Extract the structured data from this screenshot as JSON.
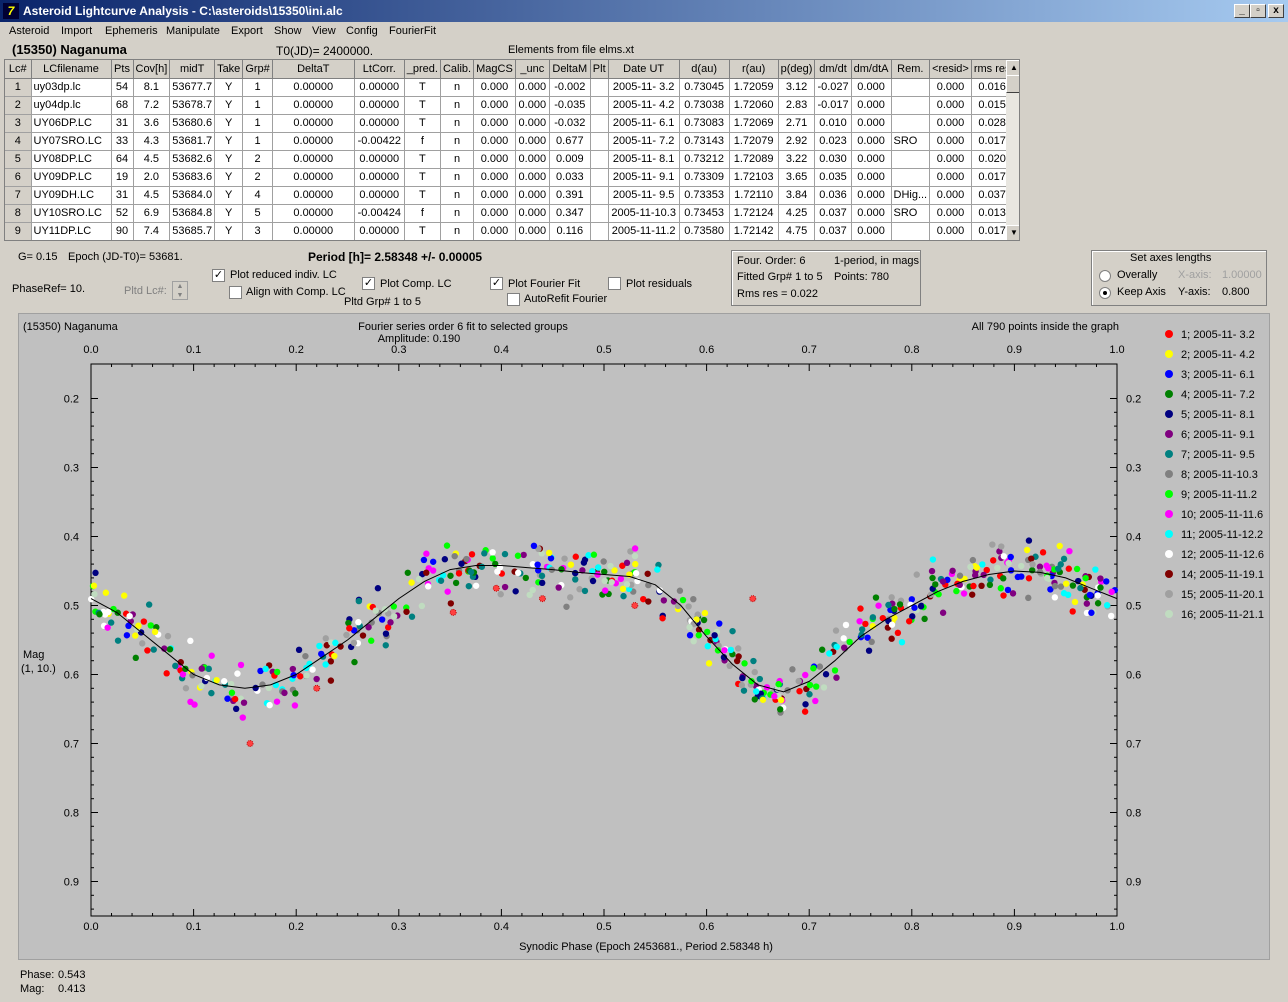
{
  "window": {
    "title": "Asteroid Lightcurve Analysis - C:\\asteroids\\15350\\ini.alc",
    "controls": [
      "_",
      "▫",
      "x"
    ]
  },
  "menu": [
    "Asteroid",
    "Import",
    "Ephemeris",
    "Manipulate",
    "Export",
    "Show",
    "View",
    "Config",
    "FourierFit"
  ],
  "header": {
    "asteroid": "(15350) Naganuma",
    "t0": "T0(JD)= 2400000.",
    "elements": "Elements from file elms.xt"
  },
  "table": {
    "columns": [
      "Lc#",
      "LCfilename",
      "Pts",
      "Cov[h]",
      "midT",
      "Take",
      "Grp#",
      "DeltaT",
      "LtCorr.",
      "_pred.",
      "Calib.",
      "MagCS",
      "_unc",
      "DeltaM",
      "Plt",
      "Date UT",
      "d(au)",
      "r(au)",
      "p(deg)",
      "dm/dt",
      "dm/dtA",
      "Rem.",
      "<resid>",
      "rms res"
    ],
    "rows": [
      [
        "1",
        "uy03dp.lc",
        "54",
        "8.1",
        "53677.7",
        "Y",
        "1",
        "0.00000",
        "0.00000",
        "T",
        "n",
        "0.000",
        "0.000",
        "-0.002",
        "",
        "2005-11- 3.2",
        "0.73045",
        "1.72059",
        "3.12",
        "-0.027",
        "0.000",
        "",
        "0.000",
        "0.016"
      ],
      [
        "2",
        "uy04dp.lc",
        "68",
        "7.2",
        "53678.7",
        "Y",
        "1",
        "0.00000",
        "0.00000",
        "T",
        "n",
        "0.000",
        "0.000",
        "-0.035",
        "",
        "2005-11- 4.2",
        "0.73038",
        "1.72060",
        "2.83",
        "-0.017",
        "0.000",
        "",
        "0.000",
        "0.015"
      ],
      [
        "3",
        "UY06DP.LC",
        "31",
        "3.6",
        "53680.6",
        "Y",
        "1",
        "0.00000",
        "0.00000",
        "T",
        "n",
        "0.000",
        "0.000",
        "-0.032",
        "",
        "2005-11- 6.1",
        "0.73083",
        "1.72069",
        "2.71",
        "0.010",
        "0.000",
        "",
        "0.000",
        "0.028"
      ],
      [
        "4",
        "UY07SRO.LC",
        "33",
        "4.3",
        "53681.7",
        "Y",
        "1",
        "0.00000",
        "-0.00422",
        "f",
        "n",
        "0.000",
        "0.000",
        "0.677",
        "",
        "2005-11- 7.2",
        "0.73143",
        "1.72079",
        "2.92",
        "0.023",
        "0.000",
        "SRO",
        "0.000",
        "0.017"
      ],
      [
        "5",
        "UY08DP.LC",
        "64",
        "4.5",
        "53682.6",
        "Y",
        "2",
        "0.00000",
        "0.00000",
        "T",
        "n",
        "0.000",
        "0.000",
        "0.009",
        "",
        "2005-11- 8.1",
        "0.73212",
        "1.72089",
        "3.22",
        "0.030",
        "0.000",
        "",
        "0.000",
        "0.020"
      ],
      [
        "6",
        "UY09DP.LC",
        "19",
        "2.0",
        "53683.6",
        "Y",
        "2",
        "0.00000",
        "0.00000",
        "T",
        "n",
        "0.000",
        "0.000",
        "0.033",
        "",
        "2005-11- 9.1",
        "0.73309",
        "1.72103",
        "3.65",
        "0.035",
        "0.000",
        "",
        "0.000",
        "0.017"
      ],
      [
        "7",
        "UY09DH.LC",
        "31",
        "4.5",
        "53684.0",
        "Y",
        "4",
        "0.00000",
        "0.00000",
        "T",
        "n",
        "0.000",
        "0.000",
        "0.391",
        "",
        "2005-11- 9.5",
        "0.73353",
        "1.72110",
        "3.84",
        "0.036",
        "0.000",
        "DHig...",
        "0.000",
        "0.037"
      ],
      [
        "8",
        "UY10SRO.LC",
        "52",
        "6.9",
        "53684.8",
        "Y",
        "5",
        "0.00000",
        "-0.00424",
        "f",
        "n",
        "0.000",
        "0.000",
        "0.347",
        "",
        "2005-11-10.3",
        "0.73453",
        "1.72124",
        "4.25",
        "0.037",
        "0.000",
        "SRO",
        "0.000",
        "0.013"
      ],
      [
        "9",
        "UY11DP.LC",
        "90",
        "7.4",
        "53685.7",
        "Y",
        "3",
        "0.00000",
        "0.00000",
        "T",
        "n",
        "0.000",
        "0.000",
        "0.116",
        "",
        "2005-11-11.2",
        "0.73580",
        "1.72142",
        "4.75",
        "0.037",
        "0.000",
        "",
        "0.000",
        "0.017"
      ]
    ]
  },
  "controls": {
    "g_label": "G= 0.15",
    "epoch_label": "Epoch (JD-T0)= 53681.",
    "period_label": "Period [h]= 2.58348 +/- 0.00005",
    "phaseref_label": "PhaseRef= 10.",
    "pltd_lc_label": "Pltd Lc#:",
    "plot_reduced": "Plot reduced indiv. LC",
    "align_comp": "Align with Comp. LC",
    "plot_comp": "Plot Comp. LC",
    "pltd_grp": "Pltd Grp#  1   to   5",
    "plot_fourier": "Plot Fourier Fit",
    "autorefit": "AutoRefit Fourier",
    "plot_residuals": "Plot residuals",
    "fourier_info": {
      "order": "Four. Order:  6",
      "mode": "1-period, in mags",
      "fitted": "Fitted Grp# 1 to 5",
      "points": "Points: 780",
      "rms": "Rms res      = 0.022"
    },
    "axes": {
      "title": "Set axes lengths",
      "overally": "Overally",
      "keep_axis": "Keep Axis",
      "x_axis_label": "X-axis:",
      "x_axis_value": "1.00000",
      "y_axis_label": "Y-axis:",
      "y_axis_value": "0.800"
    }
  },
  "chart_data": {
    "type": "scatter",
    "title_left": "(15350) Naganuma",
    "title_center": "Fourier series order 6 fit to selected groups",
    "subtitle_center": "Amplitude: 0.190",
    "title_right": "All 790 points inside the graph",
    "xlabel": "Synodic Phase (Epoch 2453681., Period 2.58348 h)",
    "ylabel": "Mag",
    "ylabel2": "(1, 10.)",
    "xlim": [
      0.0,
      1.0
    ],
    "ylim": [
      0.15,
      0.95
    ],
    "y_inverted": true,
    "xticks": [
      "0.0",
      "0.1",
      "0.2",
      "0.3",
      "0.4",
      "0.5",
      "0.6",
      "0.7",
      "0.8",
      "0.9",
      "1.0"
    ],
    "yticks": [
      "0.2",
      "0.3",
      "0.4",
      "0.5",
      "0.6",
      "0.7",
      "0.8",
      "0.9"
    ],
    "grid": false,
    "legend_position": "right",
    "series": [
      {
        "name": "1; 2005-11- 3.2",
        "color": "#ff0000"
      },
      {
        "name": "2; 2005-11- 4.2",
        "color": "#ffff00"
      },
      {
        "name": "3; 2005-11- 6.1",
        "color": "#0000ff"
      },
      {
        "name": "4; 2005-11- 7.2",
        "color": "#008000"
      },
      {
        "name": "5; 2005-11- 8.1",
        "color": "#000080"
      },
      {
        "name": "6; 2005-11- 9.1",
        "color": "#800080"
      },
      {
        "name": "7; 2005-11- 9.5",
        "color": "#008080"
      },
      {
        "name": "8; 2005-11-10.3",
        "color": "#808080"
      },
      {
        "name": "9; 2005-11-11.2",
        "color": "#00ff00"
      },
      {
        "name": "10; 2005-11-11.6",
        "color": "#ff00ff"
      },
      {
        "name": "11; 2005-11-12.2",
        "color": "#00ffff"
      },
      {
        "name": "12; 2005-11-12.6",
        "color": "#ffffff"
      },
      {
        "name": "14; 2005-11-19.1",
        "color": "#800000"
      },
      {
        "name": "15; 2005-11-20.1",
        "color": "#a0a0a0"
      },
      {
        "name": "16; 2005-11-21.1",
        "color": "#c0dcc0"
      }
    ],
    "fourier_curve": [
      [
        0.0,
        0.49
      ],
      [
        0.025,
        0.51
      ],
      [
        0.05,
        0.54
      ],
      [
        0.075,
        0.57
      ],
      [
        0.1,
        0.6
      ],
      [
        0.125,
        0.615
      ],
      [
        0.15,
        0.62
      ],
      [
        0.175,
        0.615
      ],
      [
        0.2,
        0.6
      ],
      [
        0.225,
        0.575
      ],
      [
        0.25,
        0.55
      ],
      [
        0.275,
        0.52
      ],
      [
        0.3,
        0.49
      ],
      [
        0.325,
        0.465
      ],
      [
        0.35,
        0.448
      ],
      [
        0.375,
        0.442
      ],
      [
        0.4,
        0.442
      ],
      [
        0.425,
        0.445
      ],
      [
        0.45,
        0.448
      ],
      [
        0.475,
        0.452
      ],
      [
        0.5,
        0.455
      ],
      [
        0.525,
        0.458
      ],
      [
        0.55,
        0.47
      ],
      [
        0.575,
        0.5
      ],
      [
        0.6,
        0.545
      ],
      [
        0.625,
        0.585
      ],
      [
        0.65,
        0.615
      ],
      [
        0.675,
        0.625
      ],
      [
        0.7,
        0.61
      ],
      [
        0.725,
        0.58
      ],
      [
        0.75,
        0.545
      ],
      [
        0.775,
        0.52
      ],
      [
        0.8,
        0.5
      ],
      [
        0.825,
        0.48
      ],
      [
        0.85,
        0.465
      ],
      [
        0.875,
        0.455
      ],
      [
        0.9,
        0.45
      ],
      [
        0.925,
        0.452
      ],
      [
        0.95,
        0.46
      ],
      [
        0.975,
        0.475
      ],
      [
        1.0,
        0.49
      ]
    ],
    "residual_outliers": [
      [
        0.155,
        0.7
      ],
      [
        0.22,
        0.62
      ],
      [
        0.353,
        0.51
      ],
      [
        0.395,
        0.475
      ],
      [
        0.44,
        0.49
      ],
      [
        0.53,
        0.5
      ],
      [
        0.645,
        0.49
      ]
    ]
  },
  "status": {
    "phase_label": "Phase:",
    "phase_value": "0.543",
    "mag_label": "Mag:",
    "mag_value": "0.413"
  }
}
